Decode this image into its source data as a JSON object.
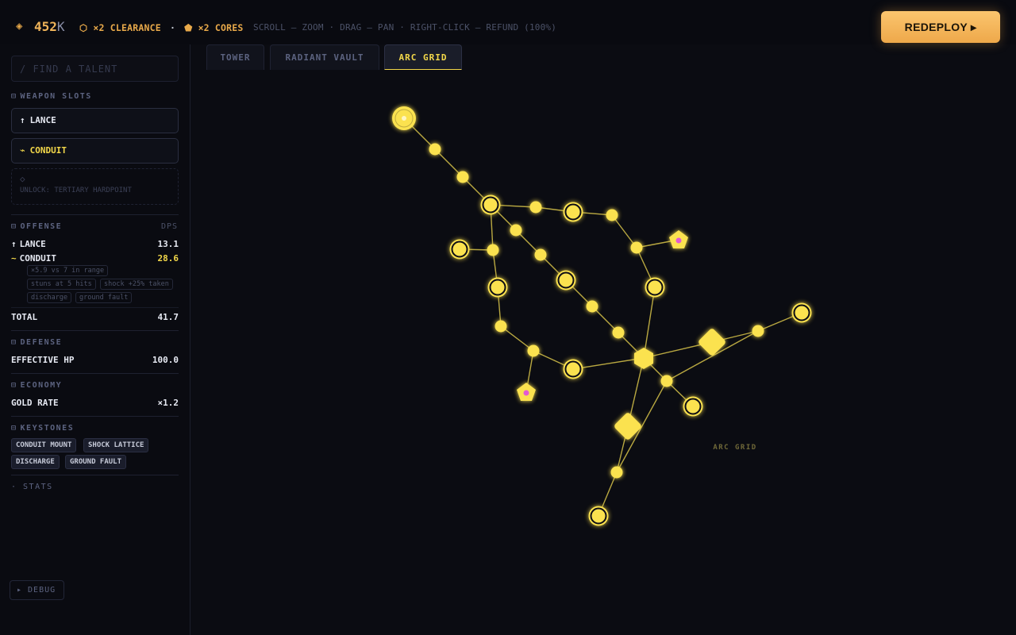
{
  "topbar": {
    "gold_icon": "gold-diamond-icon",
    "gold_amount": "452",
    "gold_unit": "K",
    "clearance_icon": "clearance-hex-icon",
    "clearance_text": "×2 CLEARANCE",
    "separator": "·",
    "cores_icon": "core-pentagon-icon",
    "cores_text": "×2 CORES",
    "hint": "SCROLL — ZOOM · DRAG — PAN · RIGHT-CLICK — REFUND (100%)",
    "redeploy_label": "REDEPLOY ▸"
  },
  "sidebar": {
    "search_placeholder": "/ FIND A TALENT",
    "weapon_slots_title": "WEAPON SLOTS",
    "slots": [
      {
        "icon": "↑",
        "label": "LANCE"
      },
      {
        "icon": "⌁",
        "label": "CONDUIT"
      }
    ],
    "locked_slot": {
      "icon": "◇",
      "label": "UNLOCK: TERTIARY HARDPOINT"
    },
    "offense": {
      "title": "OFFENSE",
      "dps_label": "DPS",
      "rows": [
        {
          "icon": "↑",
          "name": "LANCE",
          "value": "13.1"
        },
        {
          "icon": "~",
          "name": "CONDUIT",
          "value": "28.6"
        }
      ],
      "tags": [
        "×5.9 vs 7 in range",
        "stuns at 5 hits",
        "shock +25% taken",
        "discharge",
        "ground fault"
      ],
      "total_label": "TOTAL",
      "total_value": "41.7"
    },
    "defense": {
      "title": "DEFENSE",
      "label": "EFFECTIVE HP",
      "value": "100.0"
    },
    "economy": {
      "title": "ECONOMY",
      "label": "GOLD RATE",
      "value": "×1.2"
    },
    "keystones": {
      "title": "KEYSTONES",
      "items": [
        "CONDUIT MOUNT",
        "SHOCK LATTICE",
        "DISCHARGE",
        "GROUND FAULT"
      ]
    },
    "stats_toggle": "· STATS",
    "debug_label": "▸ DEBUG"
  },
  "tabs": [
    {
      "label": "TOWER",
      "active": false
    },
    {
      "label": "RADIANT VAULT",
      "active": false
    },
    {
      "label": "ARC GRID",
      "active": true
    }
  ],
  "tree": {
    "region_label": "ARC GRID",
    "colors": {
      "node": "#fbe24f",
      "edge": "#d8c44a",
      "core_dot": "#e25ad2",
      "ring": "#0b0c12"
    }
  }
}
